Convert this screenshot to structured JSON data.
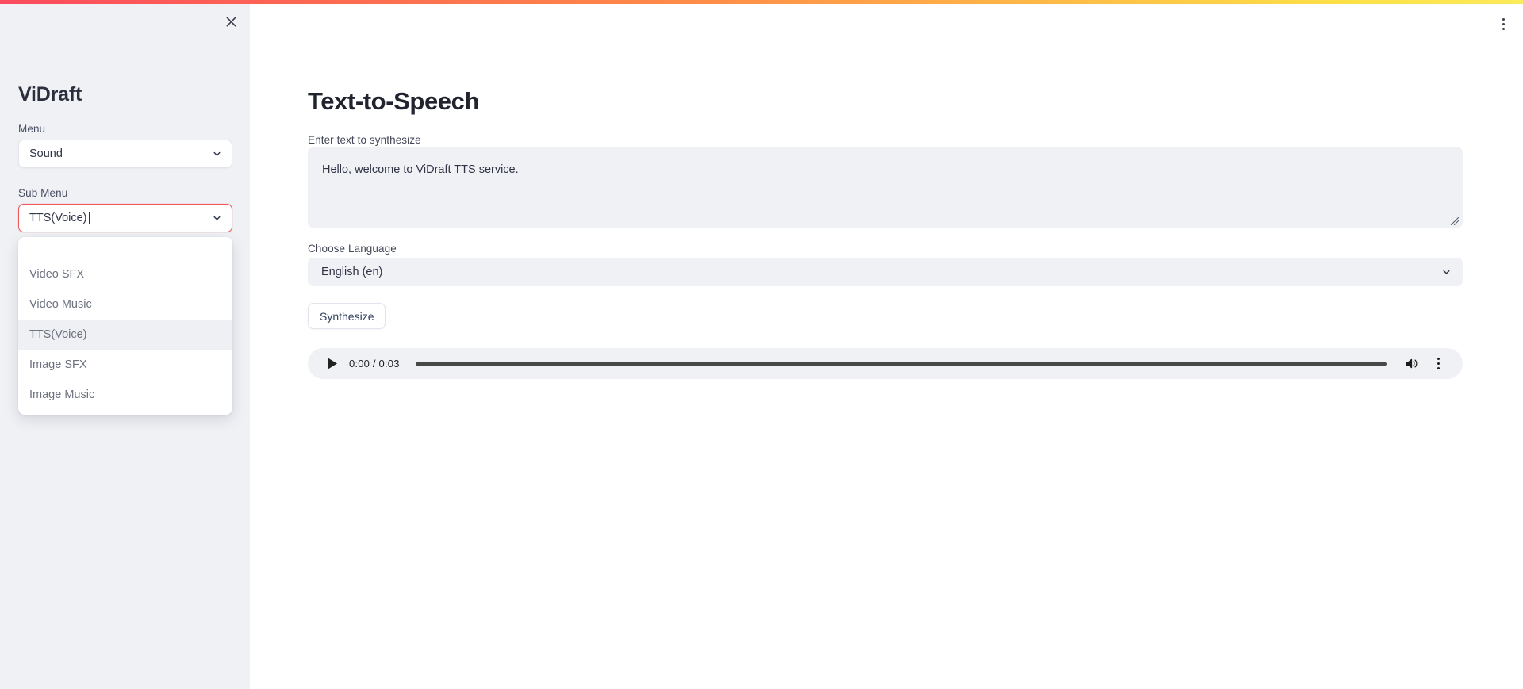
{
  "theme": {
    "gradient_start": "#fb4b5e",
    "gradient_end": "#fde047",
    "sidebar_bg": "#eff1f5",
    "field_bg": "#eff1f5",
    "focus_border": "#f0585f",
    "text_primary": "#21242f",
    "text_muted": "#6d7280"
  },
  "sidebar": {
    "close_label": "close-icon",
    "brand": "ViDraft",
    "menu": {
      "label": "Menu",
      "value": "Sound",
      "options": [
        "Sound"
      ]
    },
    "sub_menu": {
      "label": "Sub Menu",
      "value": "TTS(Voice)",
      "options": [
        "",
        "Video SFX",
        "Video Music",
        "TTS(Voice)",
        "Image SFX",
        "Image Music"
      ],
      "selected_option": "TTS(Voice)",
      "dropdown_open": true
    }
  },
  "main": {
    "top_menu_icon": "kebab-menu-icon",
    "title": "Text-to-Speech",
    "text_input": {
      "label": "Enter text to synthesize",
      "value": "Hello, welcome to ViDraft TTS service.",
      "placeholder": "Enter text to synthesize"
    },
    "language": {
      "label": "Choose Language",
      "value": "English (en)",
      "options": [
        "English (en)"
      ]
    },
    "synthesize_button": "Synthesize",
    "audio": {
      "play_icon": "play-icon",
      "time_display": "0:00 / 0:03",
      "current_time": "0:00",
      "duration": "0:03",
      "progress_percent": 0,
      "volume_icon": "volume-icon",
      "more_icon": "kebab-menu-icon"
    }
  }
}
